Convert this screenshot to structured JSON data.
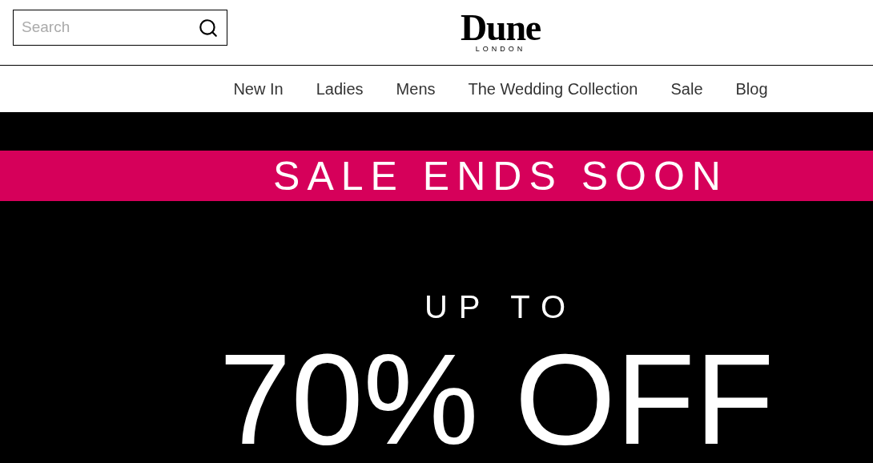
{
  "header": {
    "search": {
      "placeholder": "Search"
    },
    "logo": {
      "name": "Dune",
      "tagline": "LONDON"
    }
  },
  "nav": {
    "items": [
      {
        "label": "New In"
      },
      {
        "label": "Ladies"
      },
      {
        "label": "Mens"
      },
      {
        "label": "The Wedding Collection"
      },
      {
        "label": "Sale"
      },
      {
        "label": "Blog"
      }
    ]
  },
  "hero": {
    "banner": "SALE ENDS SOON",
    "kicker": "UP TO",
    "headline": "70% OFF"
  }
}
